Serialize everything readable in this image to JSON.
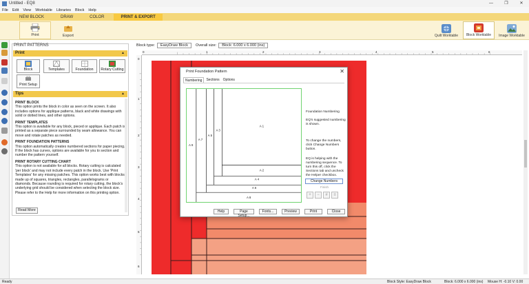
{
  "window": {
    "title": "Untitled - EQ8",
    "controls": [
      "—",
      "❐",
      "✕"
    ]
  },
  "menu": [
    "File",
    "Edit",
    "View",
    "Worktable",
    "Libraries",
    "Block",
    "Help"
  ],
  "main_tabs": [
    {
      "label": "NEW BLOCK",
      "active": false
    },
    {
      "label": "DRAW",
      "active": false
    },
    {
      "label": "COLOR",
      "active": false
    },
    {
      "label": "PRINT & EXPORT",
      "active": true
    }
  ],
  "ribbon": {
    "print_label": "Print",
    "export_label": "Export",
    "worktables": [
      {
        "label": "Quilt Worktable",
        "active": false
      },
      {
        "label": "Block Worktable",
        "active": true
      },
      {
        "label": "Image Worktable",
        "active": false
      }
    ]
  },
  "panel": {
    "title": "PRINT PATTERNS",
    "print_section": "Print",
    "buttons": [
      "Block",
      "Templates",
      "Foundation",
      "Rotary Cutting",
      "Print Setup"
    ],
    "tips_section": "Tips",
    "tips": [
      {
        "heading": "PRINT BLOCK",
        "body": "This option prints the block in color as seen on the screen. It also includes options for applique patterns, black and white drawings with solid or dotted lines, and other options."
      },
      {
        "heading": "PRINT TEMPLATES",
        "body": "This option is available for any block, pieced or applique. Each patch is printed as a separate piece surrounded by seam allowance. You can move and rotate patches as needed."
      },
      {
        "heading": "PRINT FOUNDATION PATTERNS",
        "body": "This option automatically creates numbered sections for paper piecing. If the block has curves, options are available for you to section and number the pattern yourself."
      },
      {
        "heading": "PRINT ROTARY CUTTING CHART",
        "body": "This option is not available for all blocks. Rotary cutting is calculated 'per block' and may not include every patch in the block. Use 'Print Templates' for any missing patches. This option works best with blocks made up of squares, triangles, rectangles, parallelograms or diamonds. Because rounding is required for rotary cutting, the block's underlying grid should be considered when selecting the block size. Please refer to the Help for more information on this printing option."
      }
    ],
    "read_more": "Read More"
  },
  "blockbar": {
    "block_type_label": "Block type:",
    "block_type_value": "EasyDraw Block",
    "overall_size_label": "Overall size:",
    "overall_size_value": "Block: 6.000 x 6.000 (ins)"
  },
  "ruler": {
    "h_numbers": [
      "0",
      "1",
      "2",
      "3",
      "4",
      "5",
      "6"
    ],
    "v_numbers": [
      "0",
      "1",
      "2",
      "3",
      "4",
      "5",
      "6"
    ]
  },
  "dialog": {
    "title": "Print Foundation Pattern",
    "close": "✕",
    "tabs": [
      {
        "label": "Numbering",
        "active": true
      },
      {
        "label": "Sections",
        "active": false
      },
      {
        "label": "Options",
        "active": false
      }
    ],
    "pattern_labels": [
      "A 1",
      "A 2",
      "A 3",
      "A 4",
      "A 5",
      "A 6",
      "A 7",
      "A 8",
      "A 9"
    ],
    "side_text": {
      "heading": "Foundation Numbering",
      "suggested": "EQ's suggested numbering is shown.",
      "change": "To change the numbers, click Change Numbers button.",
      "helper": "EQ is helping with the numbering sequence. To turn this off, click the Sections tab and uncheck the Helper checkbox."
    },
    "change_numbers": "Change Numbers",
    "finish_label": "Finish",
    "buttons": [
      "Help",
      "Page Setup...",
      "Fonts...",
      "Preview",
      "Print",
      "Close"
    ]
  },
  "status": {
    "ready": "Ready",
    "block_style": "Block Style: EasyDraw Block",
    "block_size": "Block: 6.000 x 6.000 (ins)",
    "mouse": "Mouse   H: -0.10   V: 0.00"
  },
  "colors": {
    "accent": "#f8c940",
    "ribbon": "#fbf3d6",
    "block_red": "#ee2b2b",
    "block_salmon": "#f28a6a"
  }
}
